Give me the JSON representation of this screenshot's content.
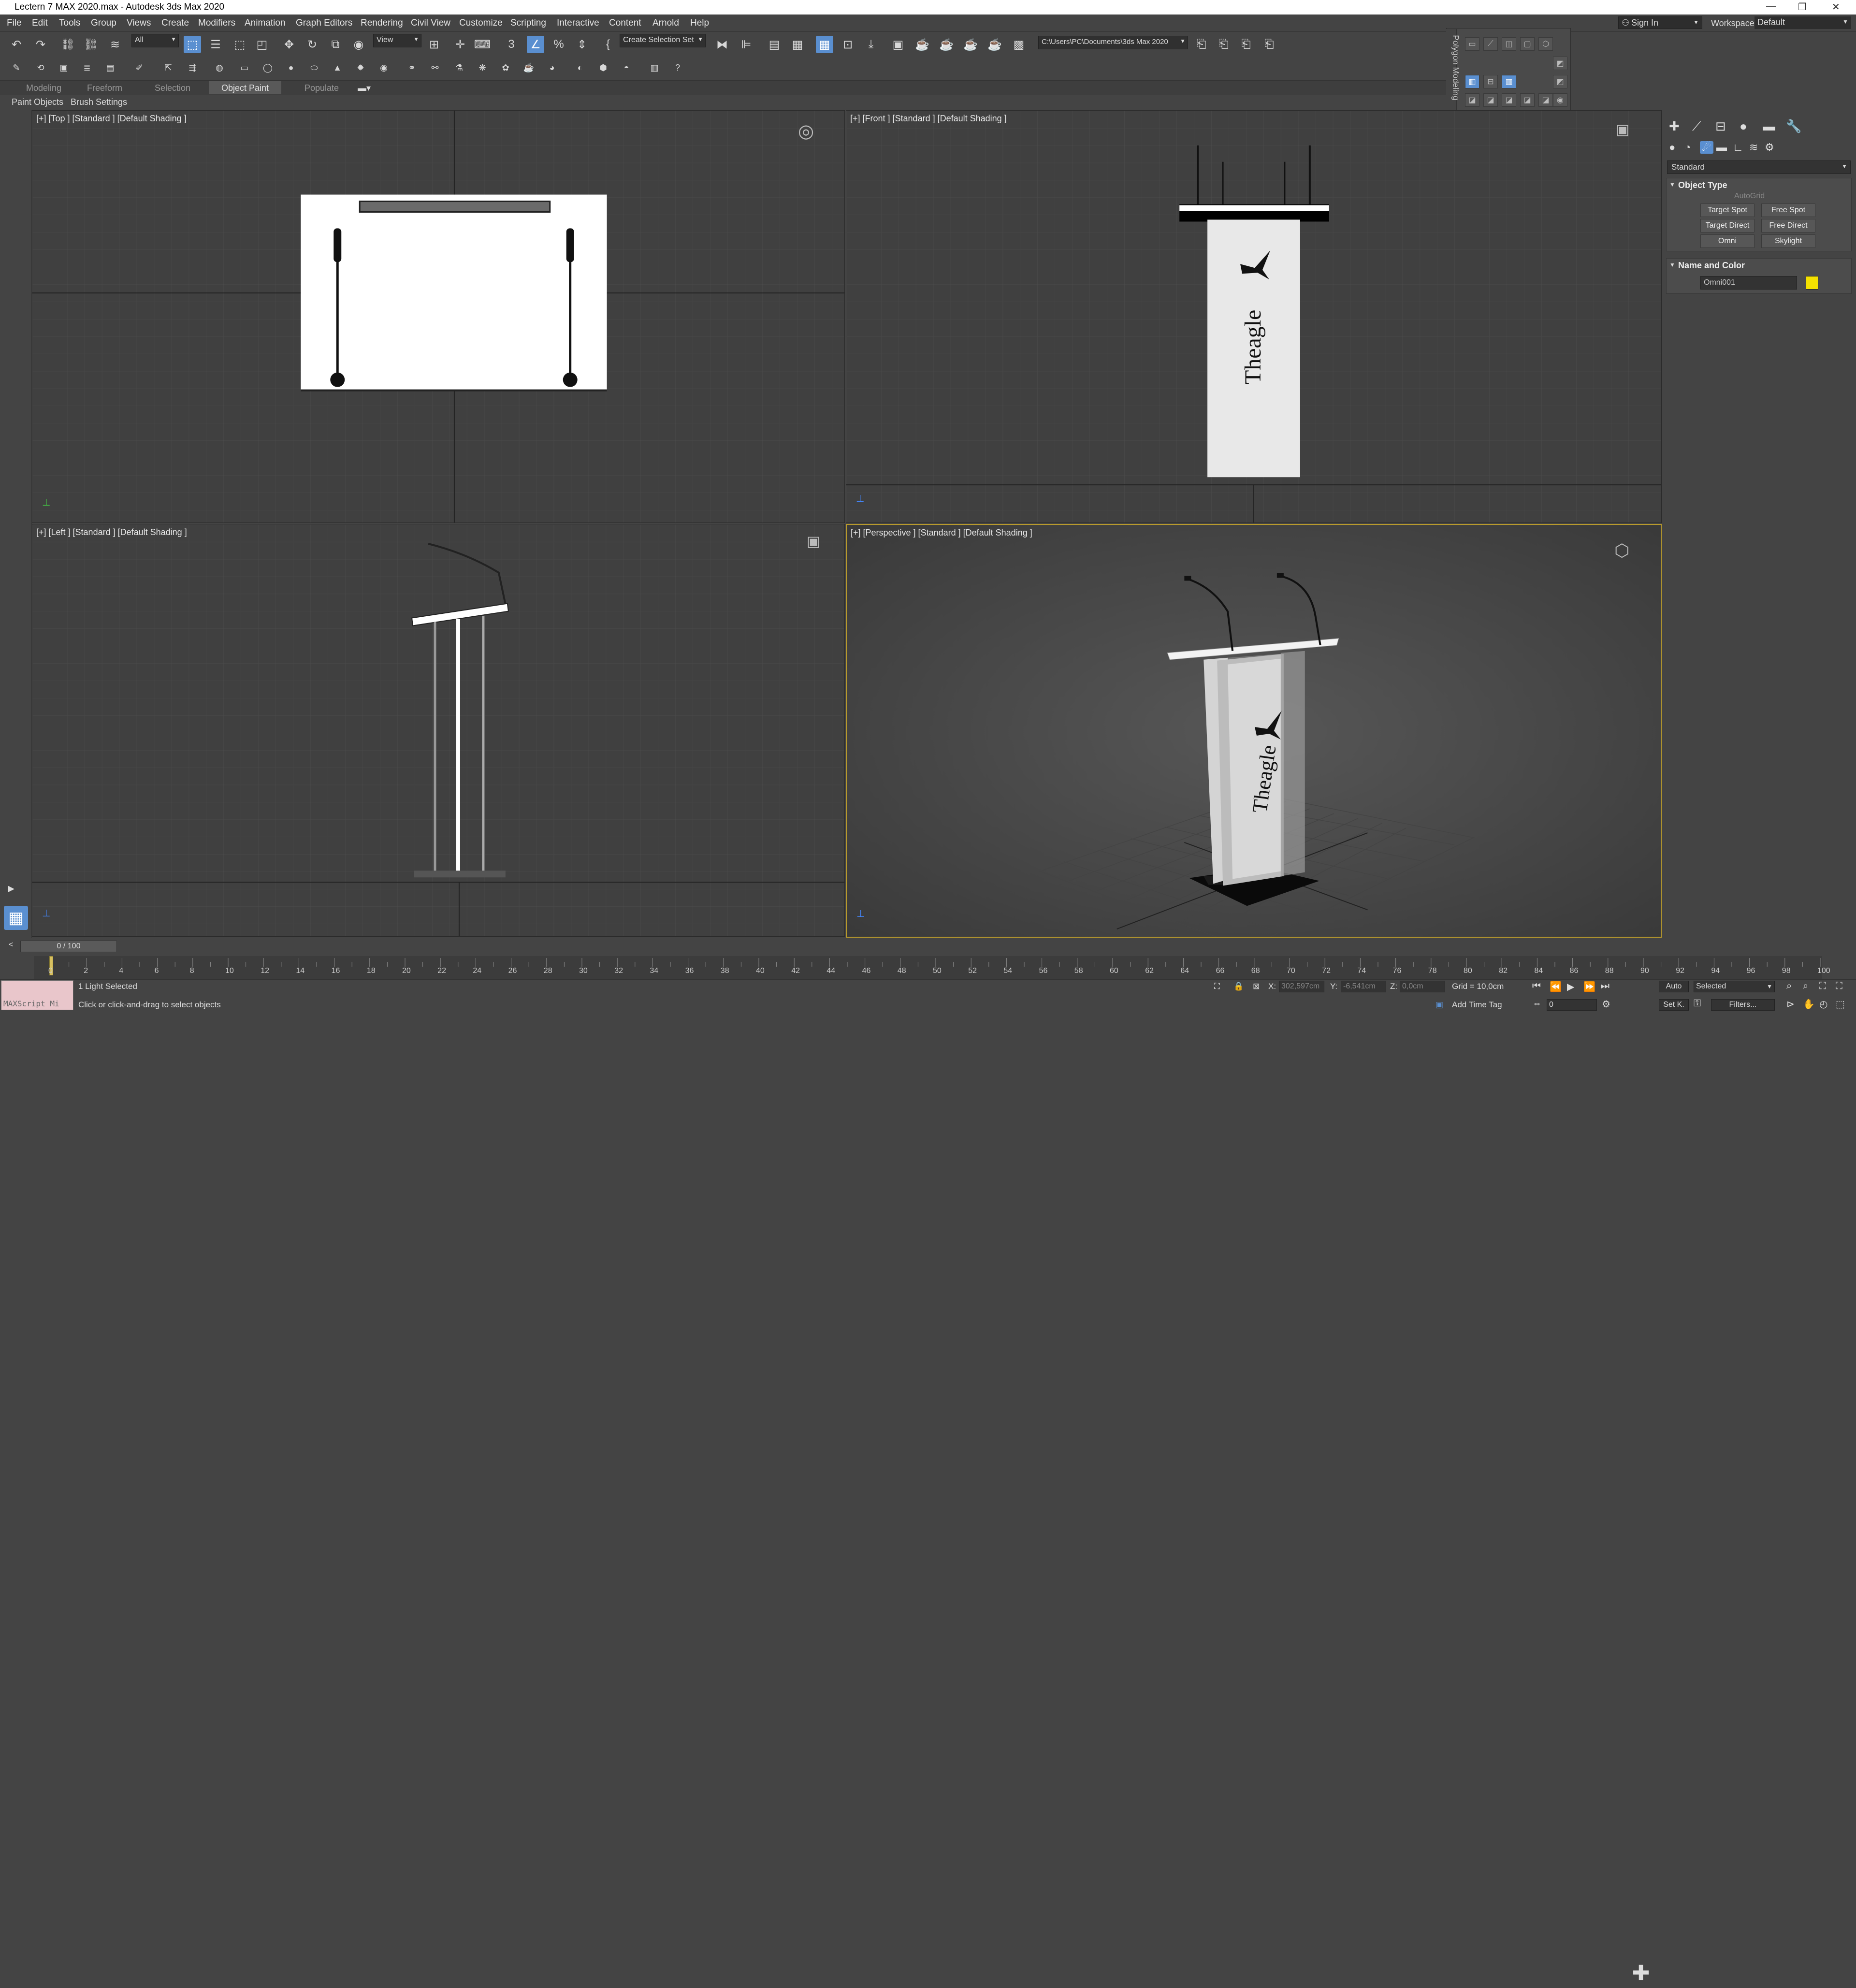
{
  "window": {
    "title": "Lectern 7 MAX 2020.max - Autodesk 3ds Max 2020",
    "minimize": "—",
    "restore": "❐",
    "close": "✕"
  },
  "menu": [
    "File",
    "Edit",
    "Tools",
    "Group",
    "Views",
    "Create",
    "Modifiers",
    "Animation",
    "Graph Editors",
    "Rendering",
    "Civil View",
    "Customize",
    "Scripting",
    "Interactive",
    "Content",
    "Arnold",
    "Help"
  ],
  "account": {
    "signin": "Sign In",
    "workspaces_label": "Workspaces:",
    "workspace": "Default"
  },
  "toolbar": {
    "selection_filter": "All",
    "ref_coord": "View",
    "selection_set": "Create Selection Set",
    "project_path": "C:\\Users\\PC\\Documents\\3ds Max 2020"
  },
  "ribbon": {
    "tabs": [
      "Modeling",
      "Freeform",
      "Selection",
      "Object Paint",
      "Populate"
    ],
    "active_tab": "Object Paint",
    "panels": [
      "Paint Objects",
      "Brush Settings"
    ],
    "polygon_modeling": "Polygon Modeling"
  },
  "viewports": {
    "top": "[+] [Top ] [Standard ] [Default Shading ]",
    "front": "[+] [Front ] [Standard ] [Default Shading ]",
    "left": "[+] [Left ] [Standard ] [Default Shading ]",
    "perspective": "[+] [Perspective ] [Standard ] [Default Shading ]",
    "logo_text": "Theagle"
  },
  "command_panel": {
    "category": "Standard",
    "object_type": {
      "title": "Object Type",
      "autogrid": "AutoGrid",
      "buttons": [
        "Target Spot",
        "Free Spot",
        "Target Direct",
        "Free Direct",
        "Omni",
        "Skylight"
      ]
    },
    "name_color": {
      "title": "Name and Color",
      "name": "Omni001",
      "color": "#f5e100"
    }
  },
  "timeline": {
    "slider": "0 / 100",
    "ticks": [
      "0",
      "2",
      "4",
      "6",
      "8",
      "10",
      "12",
      "14",
      "16",
      "18",
      "20",
      "22",
      "24",
      "26",
      "28",
      "30",
      "32",
      "34",
      "36",
      "38",
      "40",
      "42",
      "44",
      "46",
      "48",
      "50",
      "52",
      "54",
      "56",
      "58",
      "60",
      "62",
      "64",
      "66",
      "68",
      "70",
      "72",
      "74",
      "76",
      "78",
      "80",
      "82",
      "84",
      "86",
      "88",
      "90",
      "92",
      "94",
      "96",
      "98",
      "100"
    ]
  },
  "status": {
    "maxscript": "MAXScript Mi",
    "selected": "1 Light Selected",
    "prompt": "Click or click-and-drag to select objects",
    "x_label": "X:",
    "x_value": "302,597cm",
    "y_label": "Y:",
    "y_value": "-6,541cm",
    "z_label": "Z:",
    "z_value": "0,0cm",
    "grid": "Grid = 10,0cm",
    "add_time_tag": "Add Time Tag",
    "auto": "Auto",
    "setk": "Set K.",
    "key_filter": "Selected",
    "filters": "Filters...",
    "frame": "0"
  }
}
